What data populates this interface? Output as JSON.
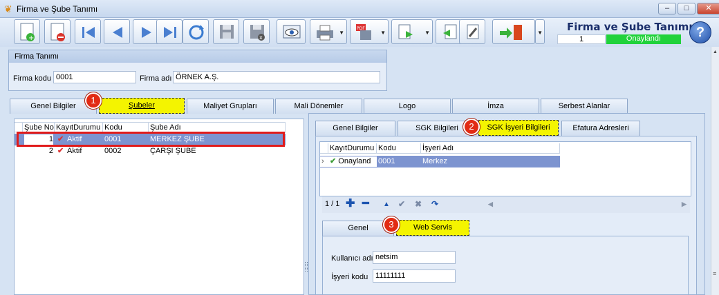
{
  "window": {
    "title": "Firma ve Şube Tanımı",
    "min": "–",
    "max": "□",
    "close": "✕"
  },
  "header": {
    "title": "Firma ve Şube Tanımı",
    "record_no": "1",
    "status": "Onaylandı",
    "help": "?"
  },
  "firma": {
    "group_title": "Firma Tanımı",
    "kod_label": "Firma kodu",
    "kod_value": "0001",
    "ad_label": "Firma adı",
    "ad_value": "ÖRNEK A.Ş."
  },
  "main_tabs": [
    "Genel Bilgiler",
    "Şubeler",
    "Maliyet Grupları",
    "Mali Dönemler",
    "Logo",
    "İmza",
    "Serbest Alanlar"
  ],
  "sube_grid": {
    "headers": [
      "Şube No",
      "KayıtDurumu",
      "Kodu",
      "Şube Adı"
    ],
    "rows": [
      {
        "no": "1",
        "durum": "Aktif",
        "kod": "0001",
        "ad": "MERKEZ ŞUBE"
      },
      {
        "no": "2",
        "durum": "Aktif",
        "kod": "0002",
        "ad": "ÇARŞI ŞUBE"
      }
    ]
  },
  "sub_tabs": [
    "Genel Bilgiler",
    "SGK Bilgileri",
    "SGK İşyeri Bilgileri",
    "Efatura Adresleri"
  ],
  "isyeri_grid": {
    "headers": [
      "KayıtDurumu",
      "Kodu",
      "İşyeri Adı"
    ],
    "rows": [
      {
        "durum": "Onayland",
        "kod": "0001",
        "ad": "Merkez"
      }
    ],
    "pager": "1 / 1"
  },
  "inner_tabs": [
    "Genel",
    "Web Servis"
  ],
  "webservis": {
    "user_label": "Kullanıcı adı",
    "user_value": "netsim",
    "code_label": "İşyeri kodu",
    "code_value": "11111111"
  },
  "badges": [
    "1",
    "2",
    "3"
  ],
  "colors": {
    "status_green": "#21d23b",
    "highlight_yellow": "#f4f400",
    "badge_red": "#e22b14",
    "selection": "#7d94d0"
  }
}
